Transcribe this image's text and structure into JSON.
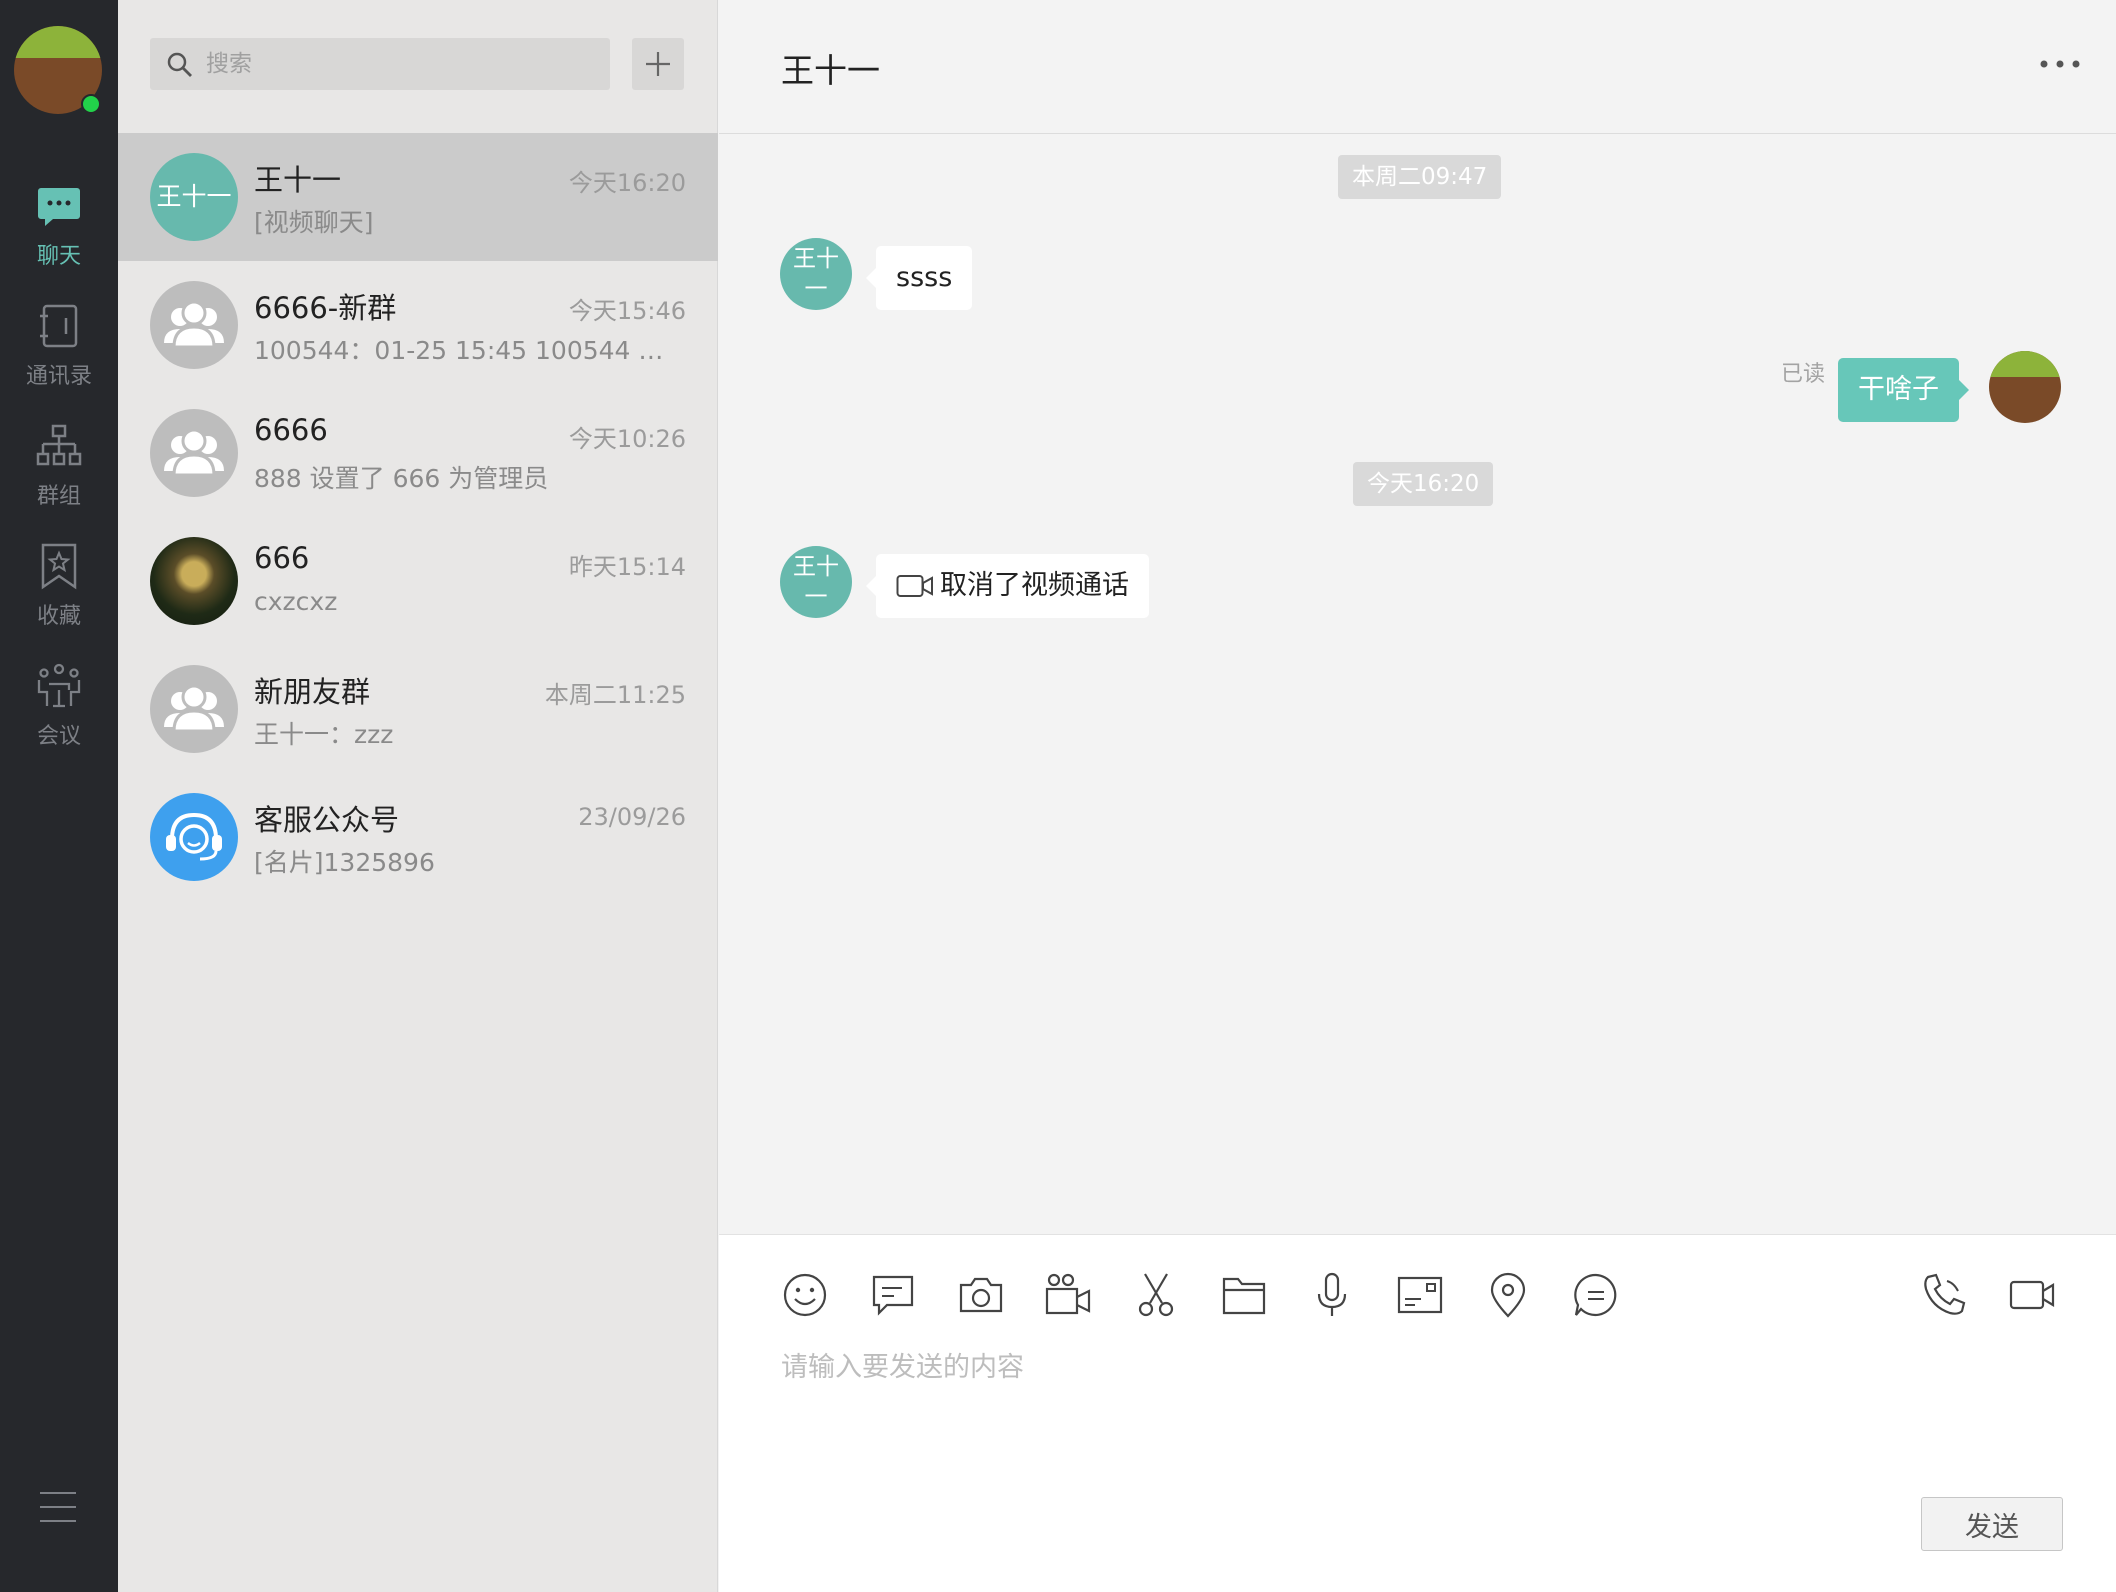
{
  "theme": {
    "accent": "#67b9ad",
    "rail_bg": "#26282c",
    "online": "#22d24a",
    "bubble_mine": "#67c7b9"
  },
  "nav": {
    "chat": "聊天",
    "contacts": "通讯录",
    "groups": "群组",
    "favorites": "收藏",
    "meeting": "会议"
  },
  "search": {
    "placeholder": "搜索"
  },
  "conversations": [
    {
      "name": "王十一",
      "time": "今天16:20",
      "preview": "[视频聊天]",
      "avatar_text": "王十一",
      "selected": true
    },
    {
      "name": "6666-新群",
      "time": "今天15:46",
      "preview": "100544：01-25 15:45 100544 ===...",
      "avatar": "group-icon"
    },
    {
      "name": "6666",
      "time": "今天10:26",
      "preview": "888 设置了 666 为管理员",
      "avatar": "group-icon"
    },
    {
      "name": "666",
      "time": "昨天15:14",
      "preview": "cxzcxz",
      "avatar": "photo"
    },
    {
      "name": "新朋友群",
      "time": "本周二11:25",
      "preview": "王十一：zzz",
      "avatar": "group-icon"
    },
    {
      "name": "客服公众号",
      "time": "23/09/26",
      "preview": "[名片]1325896",
      "avatar": "customer-service-icon"
    }
  ],
  "chat": {
    "title": "王十一",
    "messages": [
      {
        "type": "timestamp",
        "text": "本周二09:47"
      },
      {
        "type": "incoming",
        "avatar_line1": "王十",
        "avatar_line2": "一",
        "text": "ssss"
      },
      {
        "type": "outgoing",
        "status": "已读",
        "text": "干啥子"
      },
      {
        "type": "timestamp",
        "text": "今天16:20"
      },
      {
        "type": "incoming",
        "avatar_line1": "王十",
        "avatar_line2": "一",
        "text": "取消了视频通话",
        "icon": "video-icon"
      }
    ]
  },
  "composer": {
    "placeholder": "请输入要发送的内容",
    "send_label": "发送",
    "tools": [
      "emoji-icon",
      "message-icon",
      "camera-icon",
      "video-record-icon",
      "scissors-icon",
      "folder-icon",
      "microphone-icon",
      "card-icon",
      "location-icon",
      "quick-reply-icon",
      "voice-call-icon",
      "video-call-icon"
    ]
  }
}
